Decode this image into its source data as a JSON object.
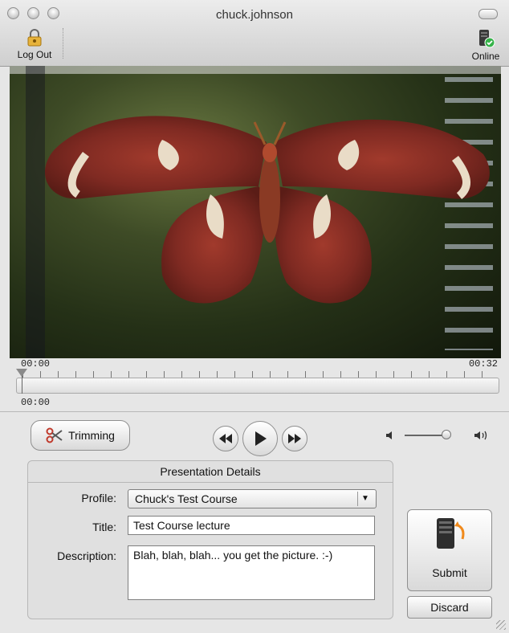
{
  "window": {
    "title": "chuck.johnson",
    "toolbar": {
      "logout_label": "Log Out",
      "online_label": "Online",
      "lock_icon": "lock-icon",
      "server_icon": "server-online-icon"
    }
  },
  "timeline": {
    "start_time": "00:00",
    "end_time": "00:32",
    "current_time": "00:00"
  },
  "controls": {
    "trimming_label": "Trimming",
    "rewind_icon": "rewind-icon",
    "play_icon": "play-icon",
    "forward_icon": "fast-forward-icon",
    "volume_low_icon": "speaker-low-icon",
    "volume_high_icon": "speaker-high-icon",
    "volume_level": 0.85
  },
  "details": {
    "header": "Presentation Details",
    "profile_label": "Profile:",
    "profile_value": "Chuck's Test Course",
    "title_label": "Title:",
    "title_value": "Test Course lecture",
    "description_label": "Description:",
    "description_value": "Blah, blah, blah... you get the picture. :-)"
  },
  "actions": {
    "submit_label": "Submit",
    "discard_label": "Discard"
  },
  "colors": {
    "moth_red": "#8a2a22",
    "moth_cream": "#e9dcc7",
    "foliage_green": "#3e4b26"
  }
}
